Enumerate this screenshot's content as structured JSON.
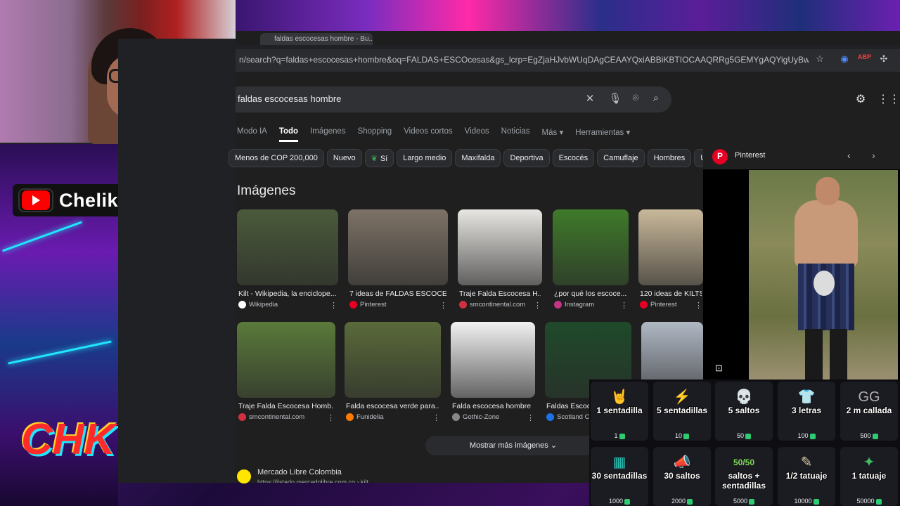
{
  "channel": {
    "name": "ChelikSama",
    "logo_text": "CHK"
  },
  "browser": {
    "tab_title": "faldas escocesas hombre - Bu...",
    "url": "n/search?q=faldas+escocesas+hombre&oq=FALDAS+ESCOcesas&gs_lcrp=EgZjaHJvbWUqDAgCEAAYQxiABBiKBTIOCAAQRRg5GEMYgAQYigUyBwgBEAAYgAQyDAgCEAAYQxiABBi..."
  },
  "search": {
    "query": "faldas escocesas hombre",
    "tabs": [
      "Modo IA",
      "Todo",
      "Imágenes",
      "Shopping",
      "Videos cortos",
      "Videos",
      "Noticias",
      "Más",
      "Herramientas"
    ],
    "active_tab": "Todo",
    "chips": [
      "Menos de COP 200,000",
      "Nuevo",
      "Sí",
      "Largo medio",
      "Maxifalda",
      "Deportiva",
      "Escocés",
      "Camuflaje",
      "Hombres",
      "Unis"
    ]
  },
  "images": {
    "title": "Imágenes",
    "row1": [
      {
        "label": "Kilt - Wikipedia, la enciclope...",
        "source": "Wikipedia",
        "color": "#4a5a3a",
        "src_color": "#ffffff"
      },
      {
        "label": "7 ideas de FALDAS ESCOCE...",
        "source": "Pinterest",
        "color": "#7d7266",
        "src_color": "#e60023"
      },
      {
        "label": "Traje Falda Escocesa H...",
        "source": "smcontinental.com",
        "color": "#e8e6e2",
        "src_color": "#d03040"
      },
      {
        "label": "¿por qué los escoce...",
        "source": "Instagram",
        "color": "#3f7a2a",
        "src_color": "#c13584"
      },
      {
        "label": "120 ideas de KILTS",
        "source": "Pinterest",
        "color": "#c9b89a",
        "src_color": "#e60023"
      }
    ],
    "row2": [
      {
        "label": "Traje Falda Escocesa Homb...",
        "source": "smcontinental.com",
        "color": "#5a7a3a",
        "src_color": "#d03040"
      },
      {
        "label": "Falda escocesa verde para...",
        "source": "Funidelia",
        "color": "#5a6a3a",
        "src_color": "#ff7a00"
      },
      {
        "label": "Falda escocesa hombre",
        "source": "Gothic-Zone",
        "color": "#f2f2f2",
        "src_color": "#888888"
      },
      {
        "label": "Faldas Escoc...",
        "source": "Scotland C...",
        "color": "#1f4a2a",
        "src_color": "#1a73e8"
      },
      {
        "label": "",
        "source": "",
        "color": "#b0b8c4",
        "src_color": "#1f1f1f"
      }
    ],
    "more_button": "Mostrar más imágenes"
  },
  "result": {
    "site": "Mercado Libre Colombia",
    "url": "https://listado.mercadolibre.com.co › kilt"
  },
  "preview": {
    "source": "Pinterest"
  },
  "rewards": [
    {
      "icon": "🤘",
      "label": "1 sentadilla",
      "cost": "1",
      "color": "#ff9a1a"
    },
    {
      "icon": "⚡",
      "label": "5 sentadillas",
      "cost": "10",
      "color": "#f5b400"
    },
    {
      "icon": "💀",
      "label": "5 saltos",
      "cost": "50",
      "color": "#8ee28e"
    },
    {
      "icon": "👕",
      "label": "3 letras",
      "cost": "100",
      "color": "#f0f0f0"
    },
    {
      "icon": "GG",
      "label": "2 m callada",
      "cost": "500",
      "color": "#b0b0b0"
    },
    {
      "icon": "▦",
      "label": "30 sentadillas",
      "cost": "1000",
      "color": "#2ec4b6"
    },
    {
      "icon": "📣",
      "label": "30 saltos",
      "cost": "2000",
      "color": "#c0c0c0"
    },
    {
      "icon": "50/50",
      "label": "saltos + sentadillas",
      "cost": "5000",
      "color": "#7ed957"
    },
    {
      "icon": "✎",
      "label": "1/2 tatuaje",
      "cost": "10000",
      "color": "#d9c7a0"
    },
    {
      "icon": "✦",
      "label": "1 tatuaje",
      "cost": "50000",
      "color": "#3fbf5f"
    }
  ]
}
